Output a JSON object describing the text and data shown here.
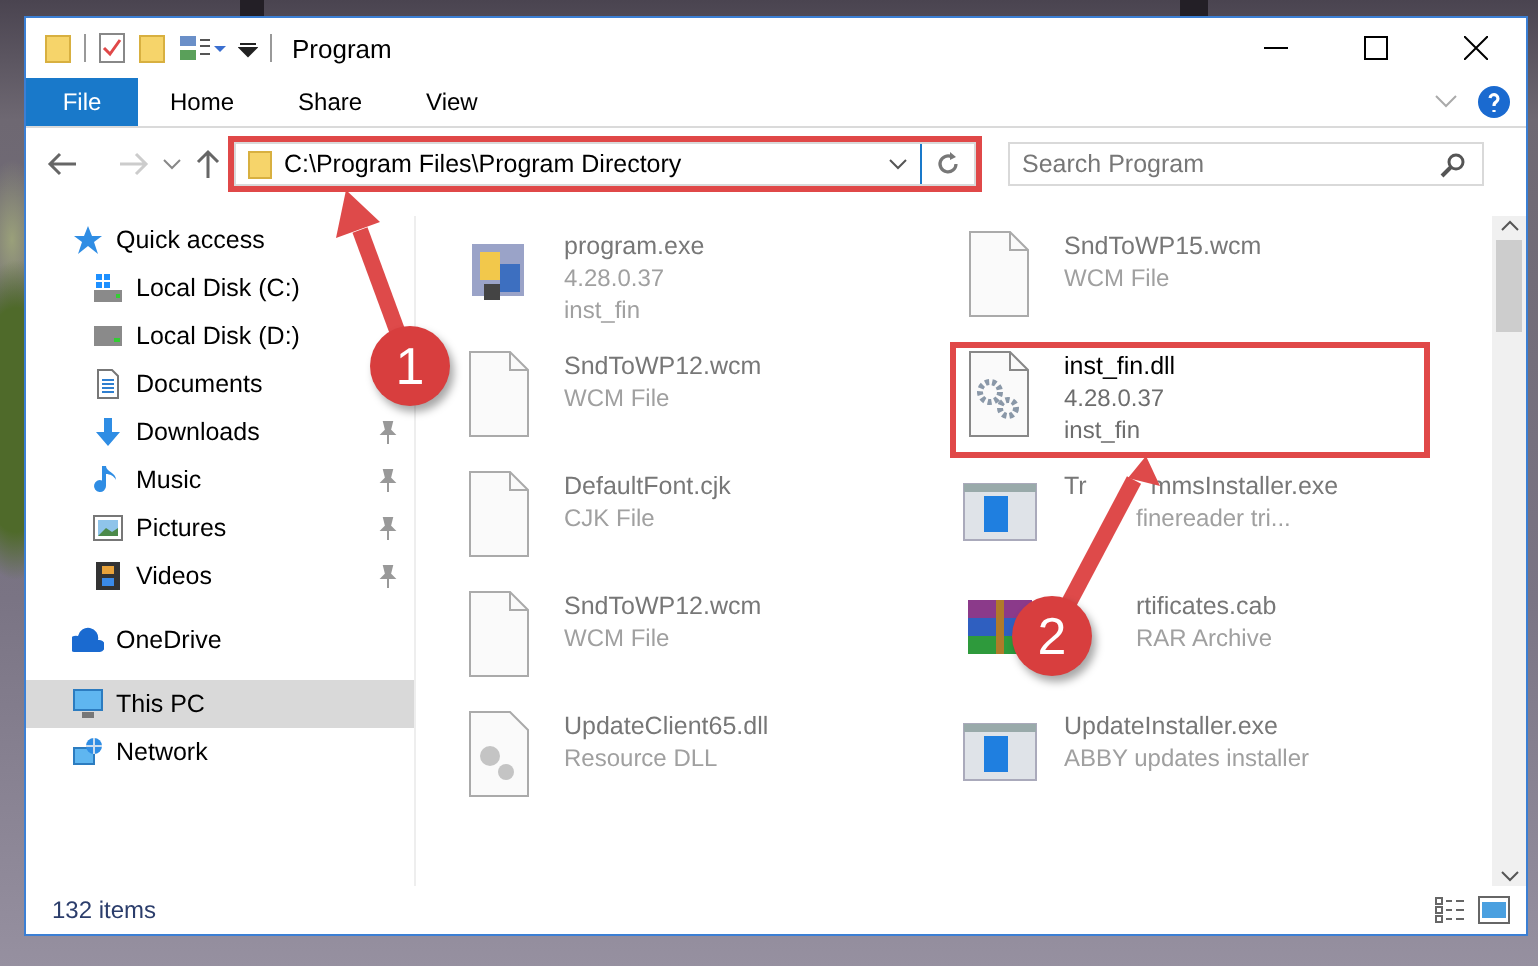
{
  "window": {
    "title": "Program"
  },
  "ribbon": {
    "tabs": [
      {
        "label": "File",
        "kind": "file-menu",
        "selected": false
      },
      {
        "label": "Home",
        "kind": "tab",
        "selected": false
      },
      {
        "label": "Share",
        "kind": "tab",
        "selected": false
      },
      {
        "label": "View",
        "kind": "tab",
        "selected": false
      }
    ]
  },
  "address_bar": {
    "path": "C:\\Program Files\\Program Directory",
    "highlighted": true
  },
  "search": {
    "placeholder": "Search Program"
  },
  "sidebar": {
    "items": [
      {
        "label": "Quick access",
        "kind": "star",
        "selected": false,
        "children": [
          {
            "label": "Local Disk (C:)",
            "kind": "drive-windows",
            "selected": false
          },
          {
            "label": "Local Disk (D:)",
            "kind": "drive",
            "selected": false
          },
          {
            "label": "Documents",
            "kind": "documents",
            "selected": false
          },
          {
            "label": "Downloads",
            "kind": "downloads",
            "selected": false,
            "pinned": true
          },
          {
            "label": "Music",
            "kind": "music",
            "selected": false,
            "pinned": true
          },
          {
            "label": "Pictures",
            "kind": "pictures",
            "selected": false,
            "pinned": true
          },
          {
            "label": "Videos",
            "kind": "videos",
            "selected": false,
            "pinned": true
          }
        ]
      },
      {
        "label": "OneDrive",
        "kind": "cloud",
        "selected": false
      },
      {
        "label": "This PC",
        "kind": "computer",
        "selected": true
      },
      {
        "label": "Network",
        "kind": "network",
        "selected": false
      }
    ]
  },
  "files": [
    {
      "name": "program.exe",
      "line_2": "4.28.0.37",
      "line_3": "inst_fin",
      "kind": "app",
      "highlighted": false
    },
    {
      "name": "SndToWP15.wcm",
      "line_2": "WCM File",
      "kind": "blank",
      "highlighted": false
    },
    {
      "name": "SndToWP12.wcm",
      "line_2": "WCM File",
      "kind": "blank",
      "highlighted": false
    },
    {
      "name": "inst_fin.dll",
      "line_2": "4.28.0.37",
      "line_3": "inst_fin",
      "kind": "dll",
      "highlighted": true
    },
    {
      "name": "DefaultFont.cjk",
      "line_2": "CJK File",
      "kind": "blank",
      "highlighted": false
    },
    {
      "name": "Tr",
      "name_after": "mmsInstaller.exe",
      "line_2": "finereader tri...",
      "kind": "installer",
      "overlapped": true,
      "highlighted": false
    },
    {
      "name": "SndToWP12.wcm",
      "line_2": "WCM File",
      "kind": "blank",
      "highlighted": false
    },
    {
      "name": "rtificates.cab",
      "line_2": "RAR Archive",
      "kind": "archive",
      "overlapped": true,
      "highlighted": false
    },
    {
      "name": "UpdateClient65.dll",
      "line_2": "Resource DLL",
      "kind": "resource",
      "highlighted": false
    },
    {
      "name": "UpdateInstaller.exe",
      "line_2": "ABBY updates installer",
      "kind": "installer",
      "highlighted": false
    }
  ],
  "status_bar": {
    "item_count": "132 items"
  },
  "annotations": [
    {
      "number": "1"
    },
    {
      "number": "2"
    }
  ]
}
